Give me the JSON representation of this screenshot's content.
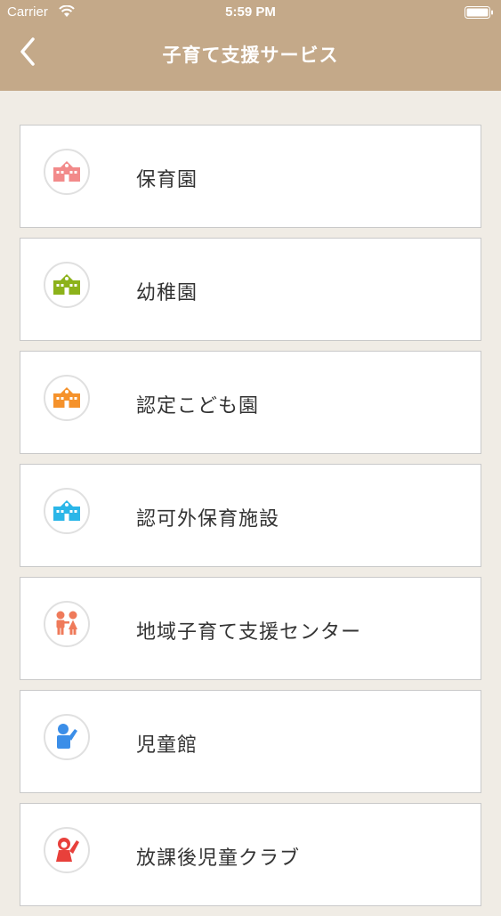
{
  "status_bar": {
    "carrier": "Carrier",
    "time": "5:59 PM",
    "wifi_icon": "wifi-icon",
    "battery_icon": "battery-icon"
  },
  "nav": {
    "title": "子育て支援サービス",
    "back_icon": "chevron-left-icon"
  },
  "items": [
    {
      "label": "保育園",
      "icon": "school-building-icon",
      "color": "#f28a8a"
    },
    {
      "label": "幼稚園",
      "icon": "school-building-icon",
      "color": "#8cb21a"
    },
    {
      "label": "認定こども園",
      "icon": "school-building-icon",
      "color": "#f5922b"
    },
    {
      "label": "認可外保育施設",
      "icon": "school-building-icon",
      "color": "#2bb6e8"
    },
    {
      "label": "地域子育て支援センター",
      "icon": "children-icon",
      "color": "#ef7a5a"
    },
    {
      "label": "児童館",
      "icon": "child-waving-icon",
      "color": "#3b8ee8"
    },
    {
      "label": "放課後児童クラブ",
      "icon": "child-raising-hand-icon",
      "color": "#e8403b"
    }
  ]
}
